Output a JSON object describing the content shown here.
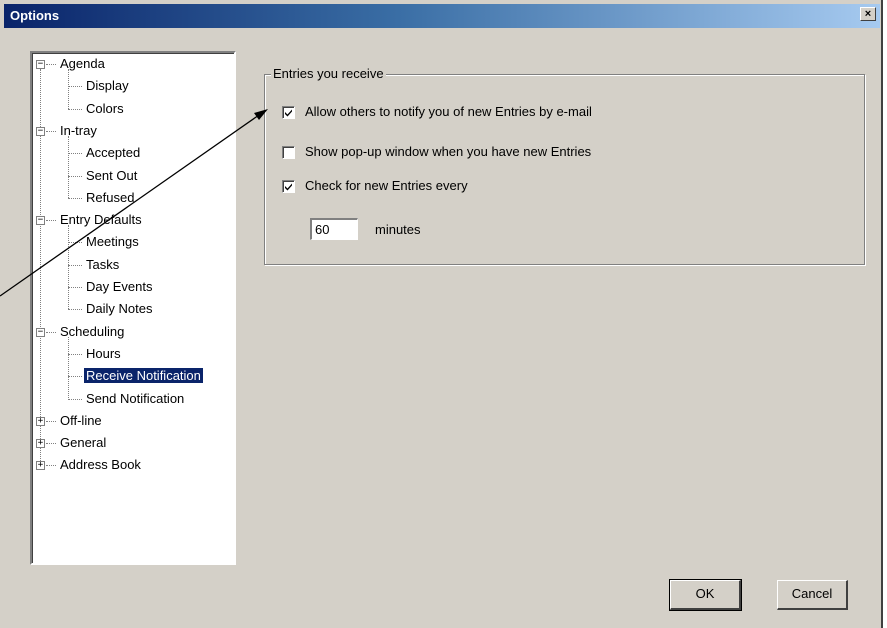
{
  "window": {
    "title": "Options",
    "close_glyph": "×"
  },
  "tree": [
    {
      "label": "Agenda",
      "level": 0,
      "expander": "−"
    },
    {
      "label": "Display",
      "level": 1
    },
    {
      "label": "Colors",
      "level": 1
    },
    {
      "label": "In-tray",
      "level": 0,
      "expander": "−"
    },
    {
      "label": "Accepted",
      "level": 1
    },
    {
      "label": "Sent Out",
      "level": 1
    },
    {
      "label": "Refused",
      "level": 1
    },
    {
      "label": "Entry Defaults",
      "level": 0,
      "expander": "−"
    },
    {
      "label": "Meetings",
      "level": 1
    },
    {
      "label": "Tasks",
      "level": 1
    },
    {
      "label": "Day Events",
      "level": 1
    },
    {
      "label": "Daily Notes",
      "level": 1
    },
    {
      "label": "Scheduling",
      "level": 0,
      "expander": "−"
    },
    {
      "label": "Hours",
      "level": 1
    },
    {
      "label": "Receive Notification",
      "level": 1,
      "selected": true
    },
    {
      "label": "Send Notification",
      "level": 1
    },
    {
      "label": "Off-line",
      "level": 0,
      "expander": "+"
    },
    {
      "label": "General",
      "level": 0,
      "expander": "+"
    },
    {
      "label": "Address Book",
      "level": 0,
      "expander": "+"
    }
  ],
  "group": {
    "title": "Entries you receive",
    "options": [
      {
        "label": "Allow others to notify you of new Entries by e-mail",
        "checked": true
      },
      {
        "label": "Show pop-up window when you have new Entries",
        "checked": false
      },
      {
        "label": "Check for new Entries every",
        "checked": true
      }
    ],
    "interval_value": "60",
    "interval_unit": "minutes"
  },
  "buttons": {
    "ok": "OK",
    "cancel": "Cancel"
  },
  "colors": {
    "selection": "#0a246a",
    "dialog_bg": "#d4d0c8",
    "title_start": "#0a246a",
    "title_end": "#a6caf0"
  }
}
